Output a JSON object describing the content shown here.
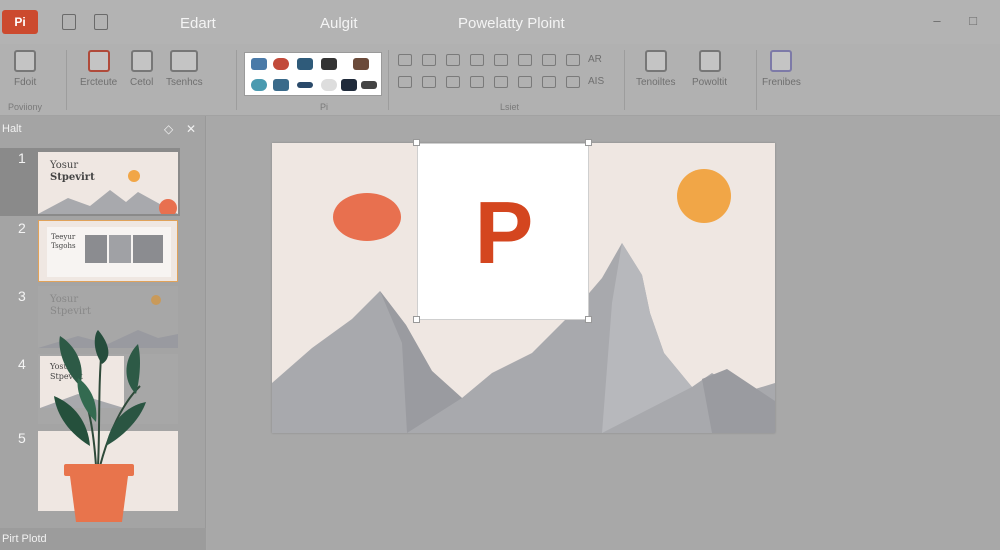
{
  "titlebar": {
    "app_logo": "Pi",
    "tabs": [
      "Edart",
      "Aulgit",
      "Powelatty Ploint"
    ],
    "window_controls": [
      "–",
      "□"
    ]
  },
  "ribbon": {
    "buttons": [
      {
        "label": "Fdoit",
        "icon": "pointer-icon"
      },
      {
        "label": "Ercteute",
        "icon": "slide-icon"
      },
      {
        "label": "Cetol",
        "icon": "document-icon"
      },
      {
        "label": "Tsenhcs",
        "icon": "layout-icon"
      },
      {
        "label": "Tenoiltes",
        "icon": "image-icon"
      },
      {
        "label": "Powoltit",
        "icon": "page-icon"
      },
      {
        "label": "Frenibes",
        "icon": "feather-icon"
      }
    ],
    "group_labels": [
      "Poviiony",
      "Pi",
      "Lsiet"
    ],
    "dropdowns": [
      "AR",
      "AIS"
    ]
  },
  "panel": {
    "title": "Halt",
    "controls": [
      "◇",
      "✕"
    ],
    "slides": [
      {
        "number": "1",
        "title_line1": "Yosur",
        "title_line2": "Stpevirt"
      },
      {
        "number": "2",
        "title_line1": "Teeyur",
        "title_line2": "Tsgohs"
      },
      {
        "number": "3",
        "title_line1": "Yosur",
        "title_line2": "Stpevirt"
      },
      {
        "number": "4",
        "title_line1": "Yosur",
        "title_line2": "Stpevirt"
      },
      {
        "number": "5",
        "title_line1": "",
        "title_line2": ""
      }
    ],
    "footer": "Pirt Plotd"
  },
  "slide": {
    "logo_letter": "P"
  },
  "colors": {
    "accent": "#d4461f",
    "sun": "#f1a647",
    "oval": "#e8704f",
    "mountain": "#a8a9ad",
    "slide_bg": "#efe7e2"
  }
}
